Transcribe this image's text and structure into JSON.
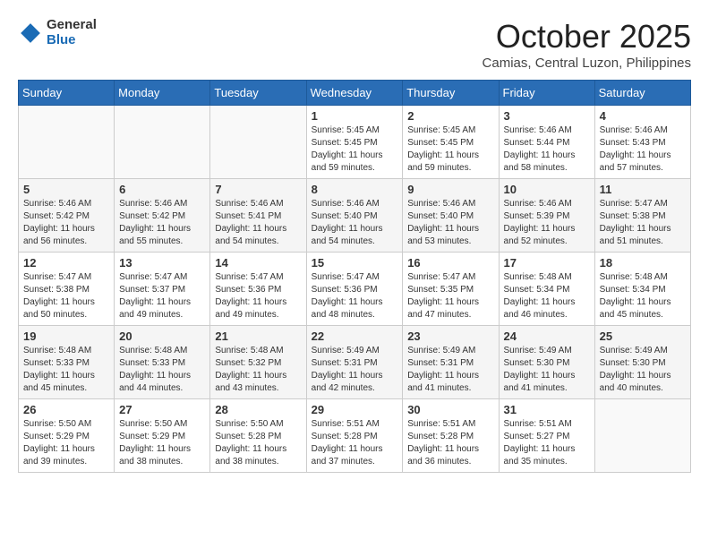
{
  "logo": {
    "general": "General",
    "blue": "Blue"
  },
  "title": "October 2025",
  "location": "Camias, Central Luzon, Philippines",
  "weekdays": [
    "Sunday",
    "Monday",
    "Tuesday",
    "Wednesday",
    "Thursday",
    "Friday",
    "Saturday"
  ],
  "weeks": [
    [
      {
        "day": "",
        "info": ""
      },
      {
        "day": "",
        "info": ""
      },
      {
        "day": "",
        "info": ""
      },
      {
        "day": "1",
        "info": "Sunrise: 5:45 AM\nSunset: 5:45 PM\nDaylight: 11 hours\nand 59 minutes."
      },
      {
        "day": "2",
        "info": "Sunrise: 5:45 AM\nSunset: 5:45 PM\nDaylight: 11 hours\nand 59 minutes."
      },
      {
        "day": "3",
        "info": "Sunrise: 5:46 AM\nSunset: 5:44 PM\nDaylight: 11 hours\nand 58 minutes."
      },
      {
        "day": "4",
        "info": "Sunrise: 5:46 AM\nSunset: 5:43 PM\nDaylight: 11 hours\nand 57 minutes."
      }
    ],
    [
      {
        "day": "5",
        "info": "Sunrise: 5:46 AM\nSunset: 5:42 PM\nDaylight: 11 hours\nand 56 minutes."
      },
      {
        "day": "6",
        "info": "Sunrise: 5:46 AM\nSunset: 5:42 PM\nDaylight: 11 hours\nand 55 minutes."
      },
      {
        "day": "7",
        "info": "Sunrise: 5:46 AM\nSunset: 5:41 PM\nDaylight: 11 hours\nand 54 minutes."
      },
      {
        "day": "8",
        "info": "Sunrise: 5:46 AM\nSunset: 5:40 PM\nDaylight: 11 hours\nand 54 minutes."
      },
      {
        "day": "9",
        "info": "Sunrise: 5:46 AM\nSunset: 5:40 PM\nDaylight: 11 hours\nand 53 minutes."
      },
      {
        "day": "10",
        "info": "Sunrise: 5:46 AM\nSunset: 5:39 PM\nDaylight: 11 hours\nand 52 minutes."
      },
      {
        "day": "11",
        "info": "Sunrise: 5:47 AM\nSunset: 5:38 PM\nDaylight: 11 hours\nand 51 minutes."
      }
    ],
    [
      {
        "day": "12",
        "info": "Sunrise: 5:47 AM\nSunset: 5:38 PM\nDaylight: 11 hours\nand 50 minutes."
      },
      {
        "day": "13",
        "info": "Sunrise: 5:47 AM\nSunset: 5:37 PM\nDaylight: 11 hours\nand 49 minutes."
      },
      {
        "day": "14",
        "info": "Sunrise: 5:47 AM\nSunset: 5:36 PM\nDaylight: 11 hours\nand 49 minutes."
      },
      {
        "day": "15",
        "info": "Sunrise: 5:47 AM\nSunset: 5:36 PM\nDaylight: 11 hours\nand 48 minutes."
      },
      {
        "day": "16",
        "info": "Sunrise: 5:47 AM\nSunset: 5:35 PM\nDaylight: 11 hours\nand 47 minutes."
      },
      {
        "day": "17",
        "info": "Sunrise: 5:48 AM\nSunset: 5:34 PM\nDaylight: 11 hours\nand 46 minutes."
      },
      {
        "day": "18",
        "info": "Sunrise: 5:48 AM\nSunset: 5:34 PM\nDaylight: 11 hours\nand 45 minutes."
      }
    ],
    [
      {
        "day": "19",
        "info": "Sunrise: 5:48 AM\nSunset: 5:33 PM\nDaylight: 11 hours\nand 45 minutes."
      },
      {
        "day": "20",
        "info": "Sunrise: 5:48 AM\nSunset: 5:33 PM\nDaylight: 11 hours\nand 44 minutes."
      },
      {
        "day": "21",
        "info": "Sunrise: 5:48 AM\nSunset: 5:32 PM\nDaylight: 11 hours\nand 43 minutes."
      },
      {
        "day": "22",
        "info": "Sunrise: 5:49 AM\nSunset: 5:31 PM\nDaylight: 11 hours\nand 42 minutes."
      },
      {
        "day": "23",
        "info": "Sunrise: 5:49 AM\nSunset: 5:31 PM\nDaylight: 11 hours\nand 41 minutes."
      },
      {
        "day": "24",
        "info": "Sunrise: 5:49 AM\nSunset: 5:30 PM\nDaylight: 11 hours\nand 41 minutes."
      },
      {
        "day": "25",
        "info": "Sunrise: 5:49 AM\nSunset: 5:30 PM\nDaylight: 11 hours\nand 40 minutes."
      }
    ],
    [
      {
        "day": "26",
        "info": "Sunrise: 5:50 AM\nSunset: 5:29 PM\nDaylight: 11 hours\nand 39 minutes."
      },
      {
        "day": "27",
        "info": "Sunrise: 5:50 AM\nSunset: 5:29 PM\nDaylight: 11 hours\nand 38 minutes."
      },
      {
        "day": "28",
        "info": "Sunrise: 5:50 AM\nSunset: 5:28 PM\nDaylight: 11 hours\nand 38 minutes."
      },
      {
        "day": "29",
        "info": "Sunrise: 5:51 AM\nSunset: 5:28 PM\nDaylight: 11 hours\nand 37 minutes."
      },
      {
        "day": "30",
        "info": "Sunrise: 5:51 AM\nSunset: 5:28 PM\nDaylight: 11 hours\nand 36 minutes."
      },
      {
        "day": "31",
        "info": "Sunrise: 5:51 AM\nSunset: 5:27 PM\nDaylight: 11 hours\nand 35 minutes."
      },
      {
        "day": "",
        "info": ""
      }
    ]
  ]
}
